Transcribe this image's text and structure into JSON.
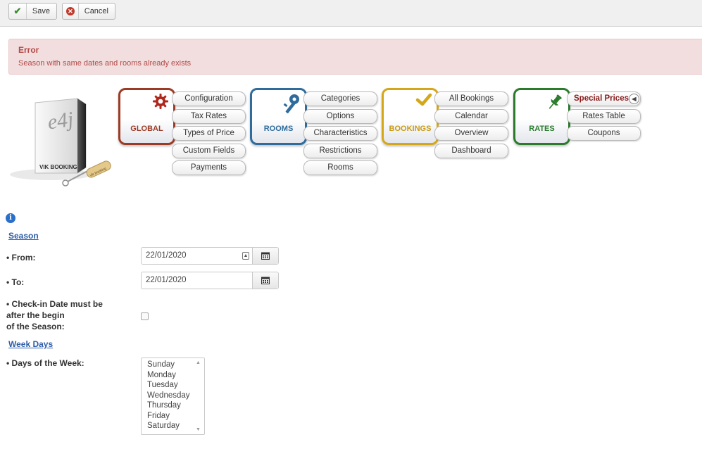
{
  "toolbar": {
    "save_label": "Save",
    "cancel_label": "Cancel"
  },
  "error": {
    "title": "Error",
    "message": "Season with same dates and rooms already exists"
  },
  "logo": {
    "brand_short": "e4j",
    "product_label": "VIK BOOKING",
    "key_tag": "vik booking"
  },
  "menu": {
    "global": {
      "label": "GLOBAL",
      "icon": "gear-icon",
      "items": [
        "Configuration",
        "Tax Rates",
        "Types of Price",
        "Custom Fields",
        "Payments"
      ]
    },
    "rooms": {
      "label": "ROOMS",
      "icon": "key-icon",
      "items": [
        "Categories",
        "Options",
        "Characteristics",
        "Restrictions",
        "Rooms"
      ]
    },
    "bookings": {
      "label": "BOOKINGS",
      "icon": "checkmark-icon",
      "items": [
        "All Bookings",
        "Calendar",
        "Overview",
        "Dashboard"
      ]
    },
    "rates": {
      "label": "RATES",
      "icon": "pin-icon",
      "items": [
        "Special Prices",
        "Rates Table",
        "Coupons"
      ],
      "active": "Special Prices"
    }
  },
  "form": {
    "season_heading": "Season",
    "from_label": "• From:",
    "from_value": "22/01/2020",
    "to_label": "• To:",
    "to_value": "22/01/2020",
    "checkin_label_line1": "• Check-in Date must be",
    "checkin_label_line2": "after the begin",
    "checkin_label_line3": "of the Season:",
    "checkin_checked": false,
    "weekdays_heading": "Week Days",
    "days_label": "• Days of the Week:",
    "days": [
      "Sunday",
      "Monday",
      "Tuesday",
      "Wednesday",
      "Thursday",
      "Friday",
      "Saturday"
    ]
  },
  "colors": {
    "global": "#9c3b25",
    "rooms": "#2f6c9c",
    "bookings": "#d4a71b",
    "rates": "#2b7b2d",
    "error_bg": "#f2dede",
    "error_text": "#b04a48",
    "link": "#2f5ea8"
  }
}
